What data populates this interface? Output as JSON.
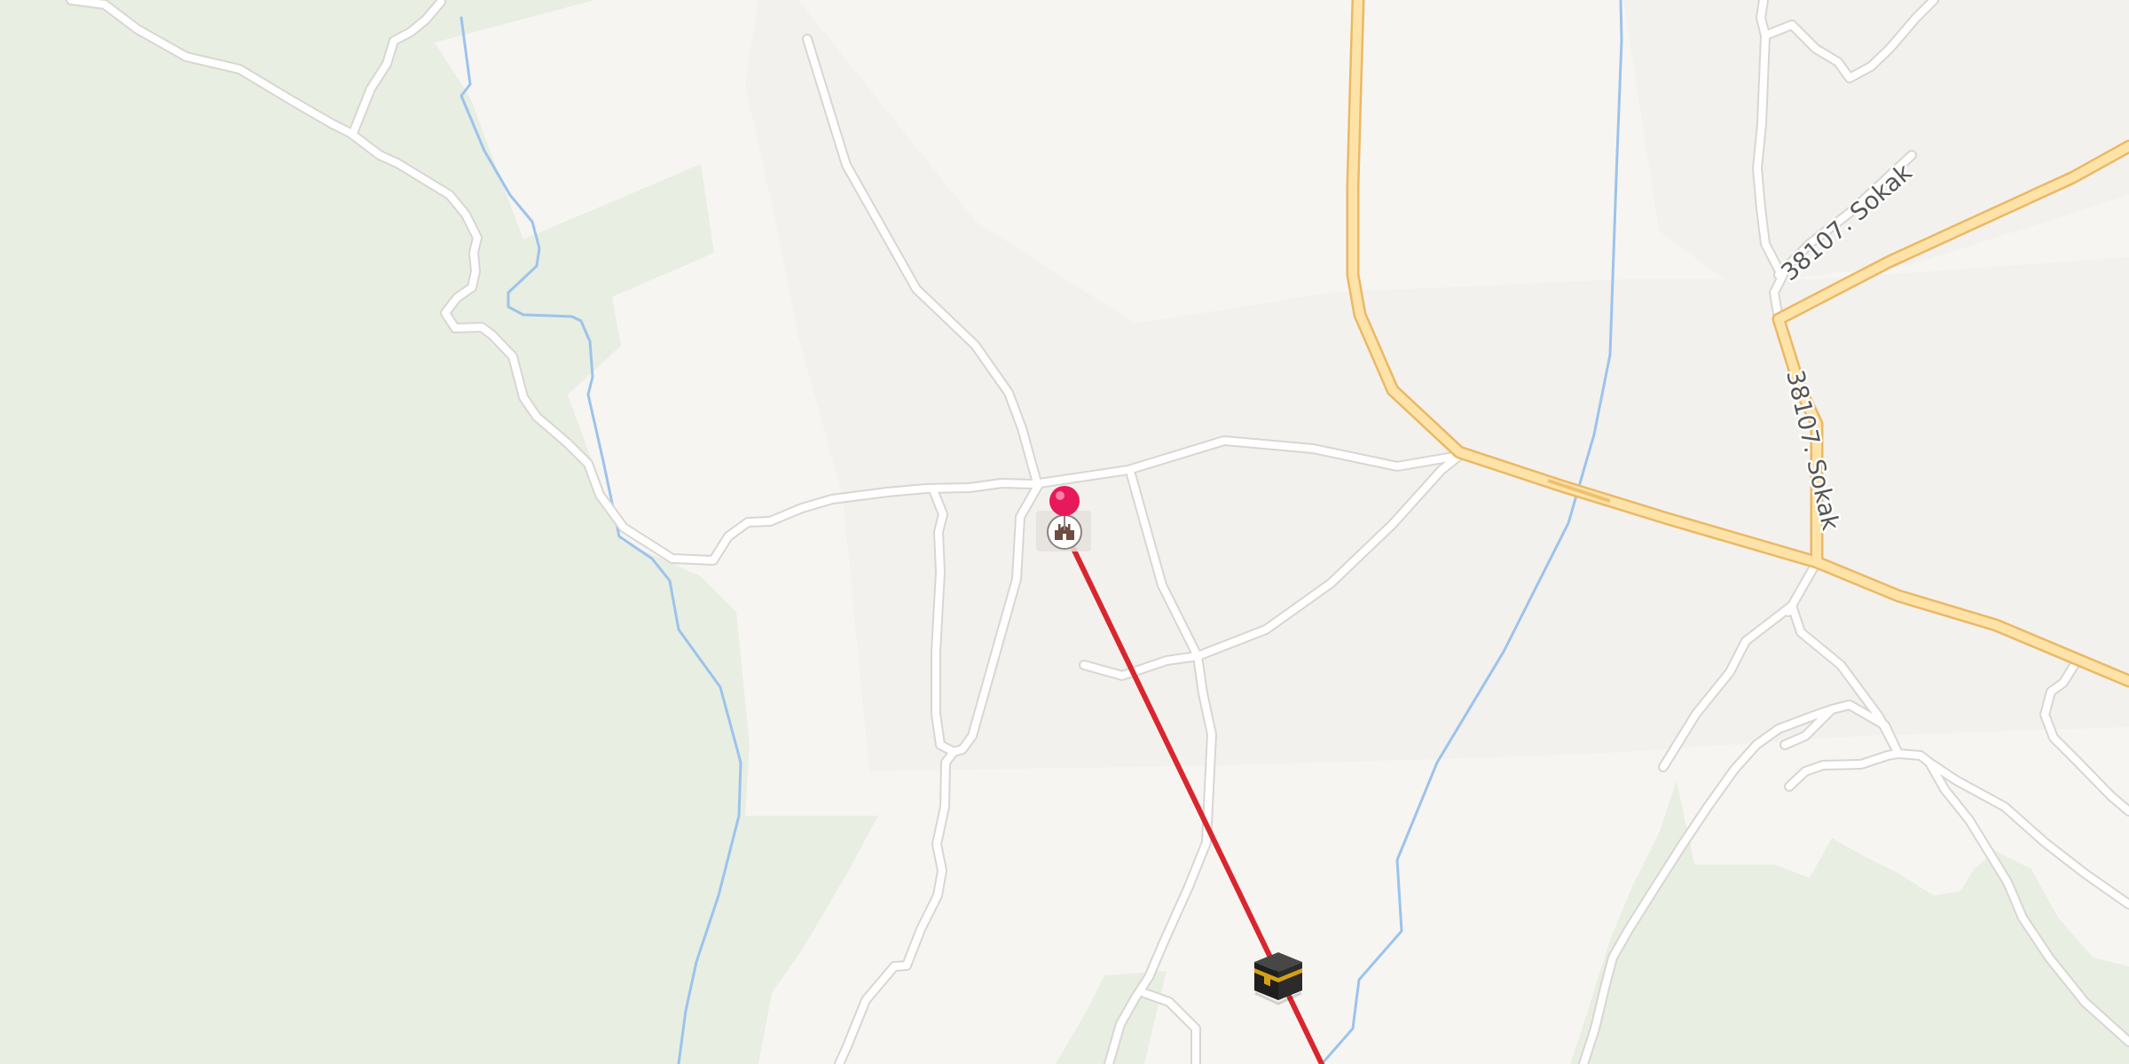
{
  "map": {
    "type": "street-map",
    "colors": {
      "land": "#f7f5f2",
      "landuse_light": "#f3f1ee",
      "vegetation": "#e8eee2",
      "minor_road_fill": "#ffffff",
      "minor_road_casing": "#d9d6d1",
      "main_road_fill": "#fde3a7",
      "main_road_casing": "#ecb864",
      "waterway": "#9cc3ec",
      "bearing_line": "#d9262e",
      "location_pin": "#e8185c",
      "mosque_icon": "#6d4c41",
      "kaaba_body": "#2b2b2b",
      "kaaba_band": "#d4a017"
    },
    "road_labels": [
      {
        "text": "38107. Sokak",
        "road": "north-east-road"
      },
      {
        "text": "38107. Sokak",
        "road": "vertical-connector"
      }
    ],
    "markers": [
      {
        "type": "location-pin",
        "icon": "pin-icon",
        "color": "#e8185c"
      },
      {
        "type": "place-of-worship",
        "icon": "mosque-icon"
      },
      {
        "type": "qibla-direction",
        "icon": "kaaba-icon"
      }
    ],
    "overlay": {
      "type": "qibla-bearing-line",
      "color": "#d9262e"
    }
  }
}
